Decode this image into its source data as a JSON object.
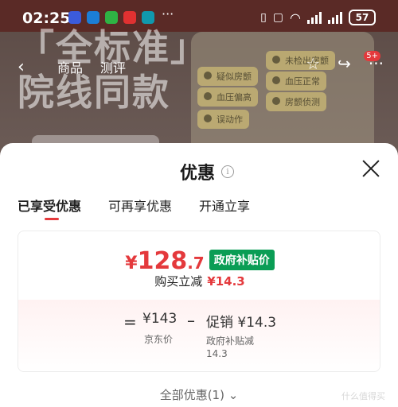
{
  "status_bar": {
    "time": "02:25",
    "battery": "57",
    "more": "···"
  },
  "background": {
    "big_line1": "「全标准」",
    "big_line2": "院线同款",
    "nav_tabs": [
      "商品",
      "测评"
    ],
    "badge": "5+",
    "chips": [
      "疑似房颤",
      "未检出房颤",
      "血压偏高",
      "血压正常",
      "误动作",
      "房颤侦测"
    ]
  },
  "sheet": {
    "title": "优惠",
    "tabs": [
      "已享受优惠",
      "可再享优惠",
      "开通立享"
    ],
    "price": {
      "yen": "¥",
      "int": "128",
      "dec": ".7"
    },
    "gov_tag": "政府补贴价",
    "buy_reduce_label": "购买立减",
    "buy_reduce_value": "¥14.3",
    "equals": "=",
    "minus": "–",
    "jd_price_value": "¥143",
    "jd_price_label": "京东价",
    "promo_value": "促销 ¥14.3",
    "promo_label_line1": "政府补贴减",
    "promo_label_line2": "14.3",
    "all_offers": "全部优惠(1)",
    "watermark": "什么值得买"
  }
}
